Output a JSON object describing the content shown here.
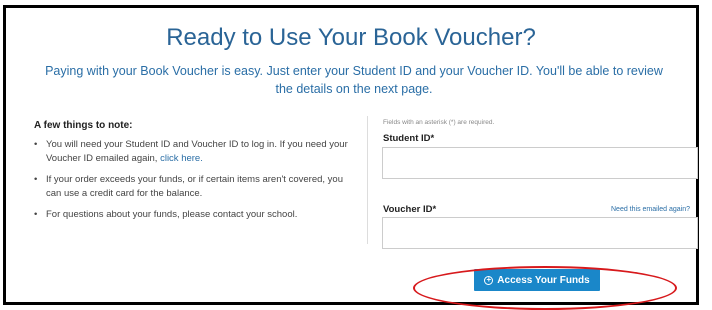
{
  "header": {
    "title": "Ready to Use Your Book Voucher?",
    "subtitle": "Paying with your Book Voucher is easy. Just enter your Student ID and your Voucher ID. You'll be able to review the details on the next page."
  },
  "notes": {
    "heading": "A few things to note:",
    "bullet_glyph": "•",
    "items": [
      {
        "text": "You will need your Student ID and Voucher ID to log in. If you need your Voucher ID emailed again, ",
        "link": "click here."
      },
      {
        "text": "If your order exceeds your funds, or if certain items aren't covered, you can use a credit card for the balance."
      },
      {
        "text": "For questions about your funds, please contact your school."
      }
    ]
  },
  "form": {
    "required_note": "Fields with an asterisk (*) are required.",
    "student_id_label": "Student ID*",
    "student_id_value": "",
    "voucher_id_label": "Voucher ID*",
    "voucher_id_value": "",
    "voucher_help_link": "Need this emailed again?",
    "submit_label": "Access Your Funds",
    "submit_icon": "plus-circle-icon"
  },
  "colors": {
    "title": "#2a6496",
    "link": "#2a6ea6",
    "button": "#1a87c9",
    "annotation": "#d7191c"
  }
}
